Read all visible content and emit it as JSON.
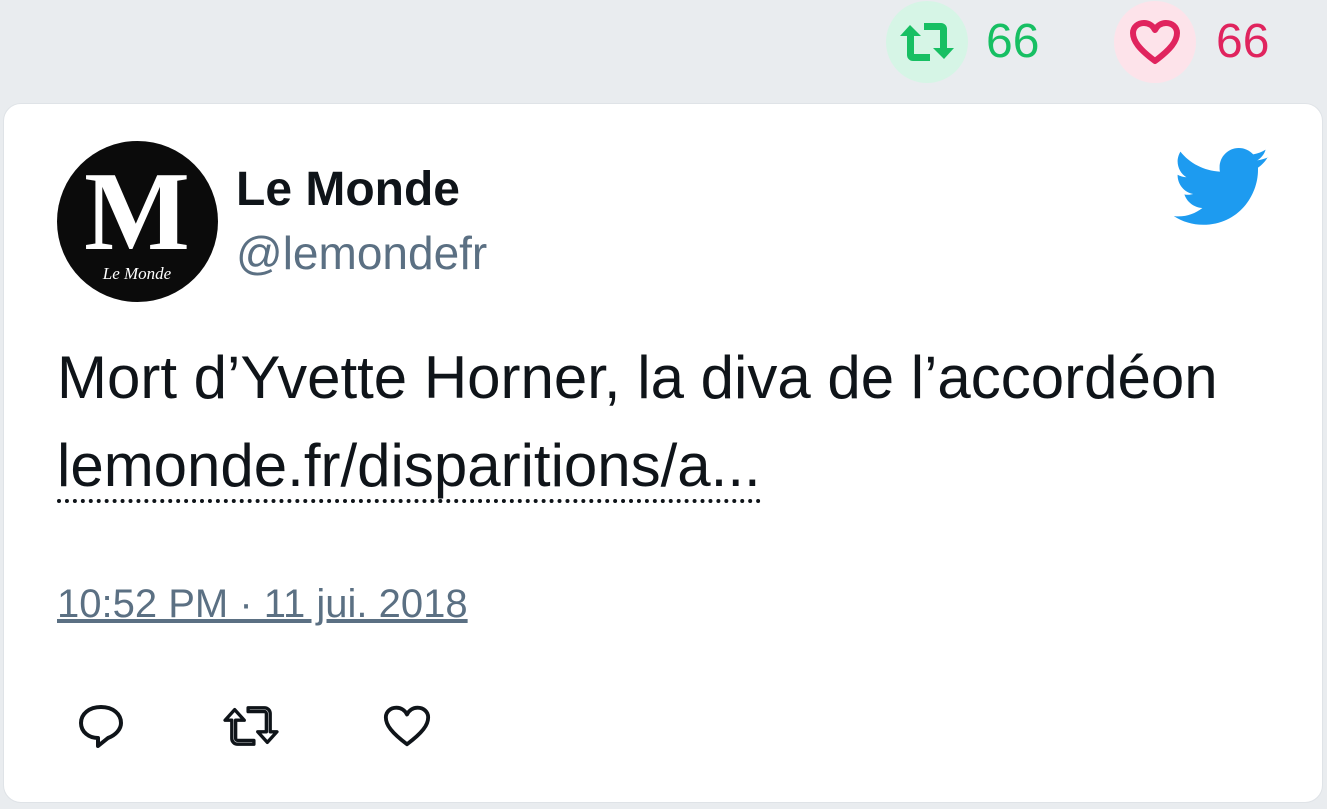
{
  "stats": {
    "retweet_count": "66",
    "like_count": "66"
  },
  "author": {
    "name": "Le Monde",
    "handle": "@lemondefr",
    "avatar_monogram": "M",
    "avatar_caption": "Le Monde"
  },
  "tweet": {
    "text": "Mort d’Yvette Horner, la diva de l’accordéon ",
    "link_text": "lemonde.fr/disparitions/a...",
    "timestamp": "10:52 PM · 11 jui. 2018"
  },
  "icons": {
    "retweet": "retweet-icon",
    "like": "heart-icon",
    "brand": "twitter-bird-icon",
    "reply": "reply-icon"
  },
  "colors": {
    "retweet_green": "#17bf63",
    "like_red": "#e0245e",
    "twitter_blue": "#1d9bf0",
    "muted_text": "#5b7083"
  }
}
